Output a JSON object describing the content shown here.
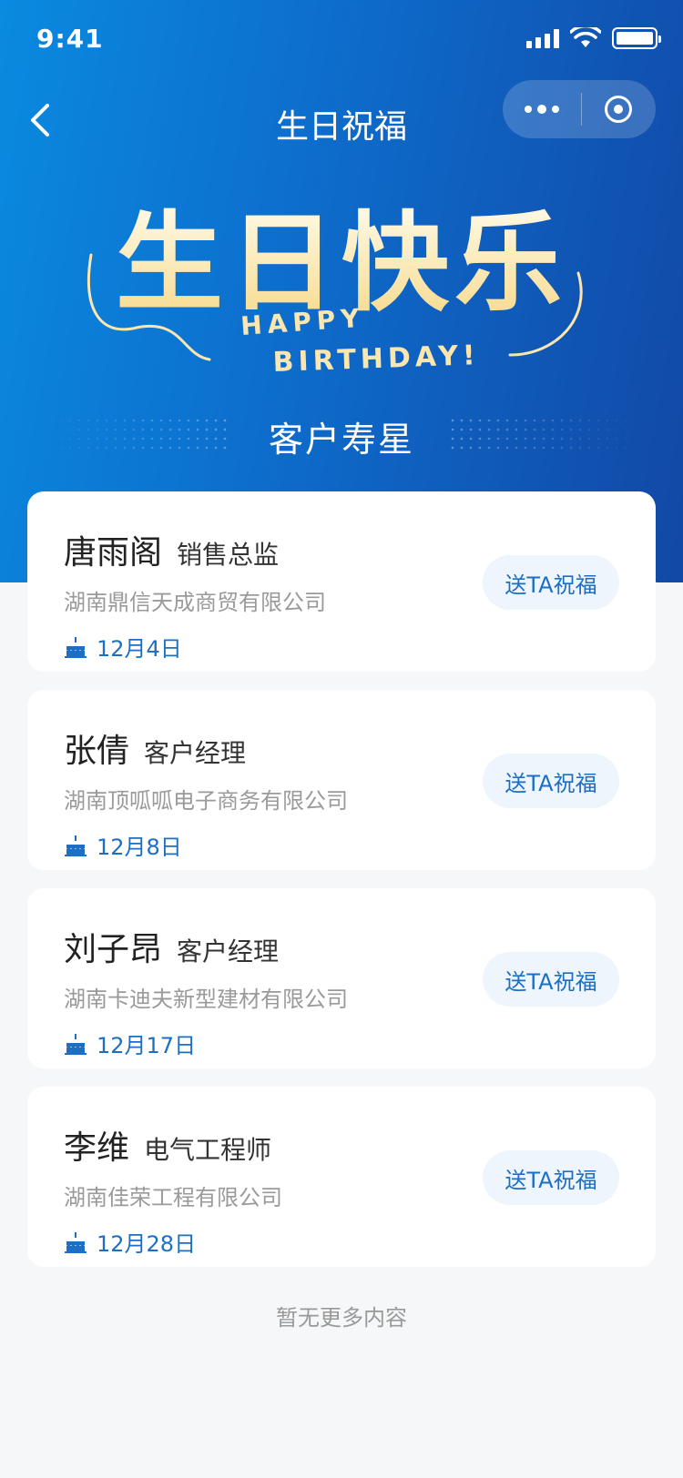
{
  "status_bar": {
    "time": "9:41"
  },
  "nav": {
    "title": "生日祝福"
  },
  "banner": {
    "headline": "生日快乐",
    "subtitle_line1": "HAPPY",
    "subtitle_line2": "BIRTHDAY!"
  },
  "section": {
    "title": "客户寿星"
  },
  "customers": [
    {
      "name": "唐雨阁",
      "position": "销售总监",
      "company": "湖南鼎信天成商贸有限公司",
      "birthday": "12月4日",
      "action": "送TA祝福"
    },
    {
      "name": "张倩",
      "position": "客户经理",
      "company": "湖南顶呱呱电子商务有限公司",
      "birthday": "12月8日",
      "action": "送TA祝福"
    },
    {
      "name": "刘子昂",
      "position": "客户经理",
      "company": "湖南卡迪夫新型建材有限公司",
      "birthday": "12月17日",
      "action": "送TA祝福"
    },
    {
      "name": "李维",
      "position": "电气工程师",
      "company": "湖南佳荣工程有限公司",
      "birthday": "12月28日",
      "action": "送TA祝福"
    }
  ],
  "footer": {
    "note": "暂无更多内容"
  }
}
